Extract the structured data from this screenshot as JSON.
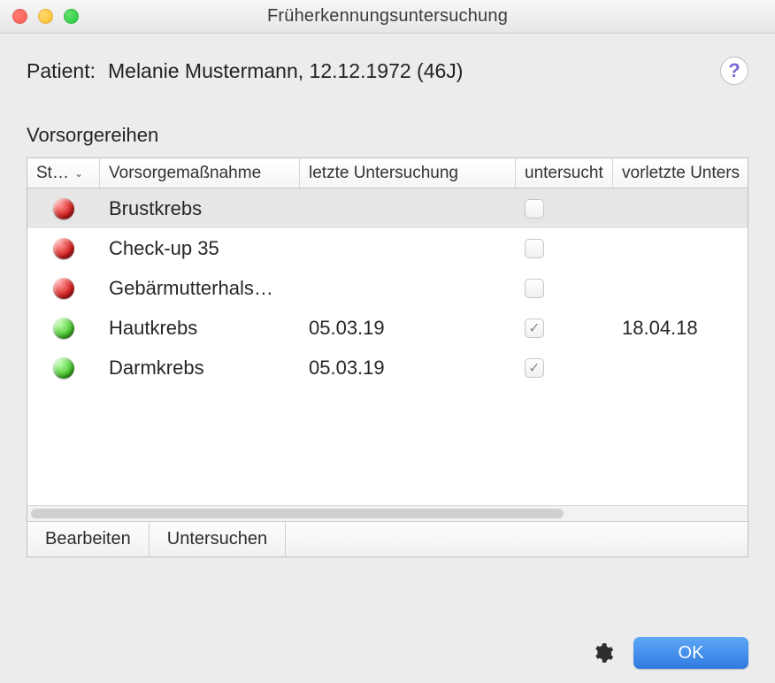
{
  "window": {
    "title": "Früherkennungsuntersuchung"
  },
  "patient": {
    "label": "Patient:",
    "value": "Melanie Mustermann, 12.12.1972 (46J)"
  },
  "help": {
    "label": "?"
  },
  "section": {
    "label": "Vorsorgereihen"
  },
  "table": {
    "headers": {
      "status": "St…",
      "name": "Vorsorgemaßnahme",
      "last": "letzte Untersuchung",
      "checked": "untersucht",
      "prev": "vorletzte Unters"
    },
    "rows": [
      {
        "status": "red",
        "name": "Brustkrebs",
        "last": "",
        "checked": false,
        "prev": "",
        "selected": true
      },
      {
        "status": "red",
        "name": "Check-up 35",
        "last": "",
        "checked": false,
        "prev": "",
        "selected": false
      },
      {
        "status": "red",
        "name": "Gebärmutterhals…",
        "last": "",
        "checked": false,
        "prev": "",
        "selected": false
      },
      {
        "status": "green",
        "name": "Hautkrebs",
        "last": "05.03.19",
        "checked": true,
        "prev": "18.04.18",
        "selected": false
      },
      {
        "status": "green",
        "name": "Darmkrebs",
        "last": "05.03.19",
        "checked": true,
        "prev": "",
        "selected": false
      }
    ]
  },
  "footer": {
    "edit": "Bearbeiten",
    "examine": "Untersuchen"
  },
  "actions": {
    "ok": "OK"
  },
  "colors": {
    "status_red": "#d61f1f",
    "status_green": "#4ac92e",
    "accent_blue": "#2f7ae0"
  }
}
